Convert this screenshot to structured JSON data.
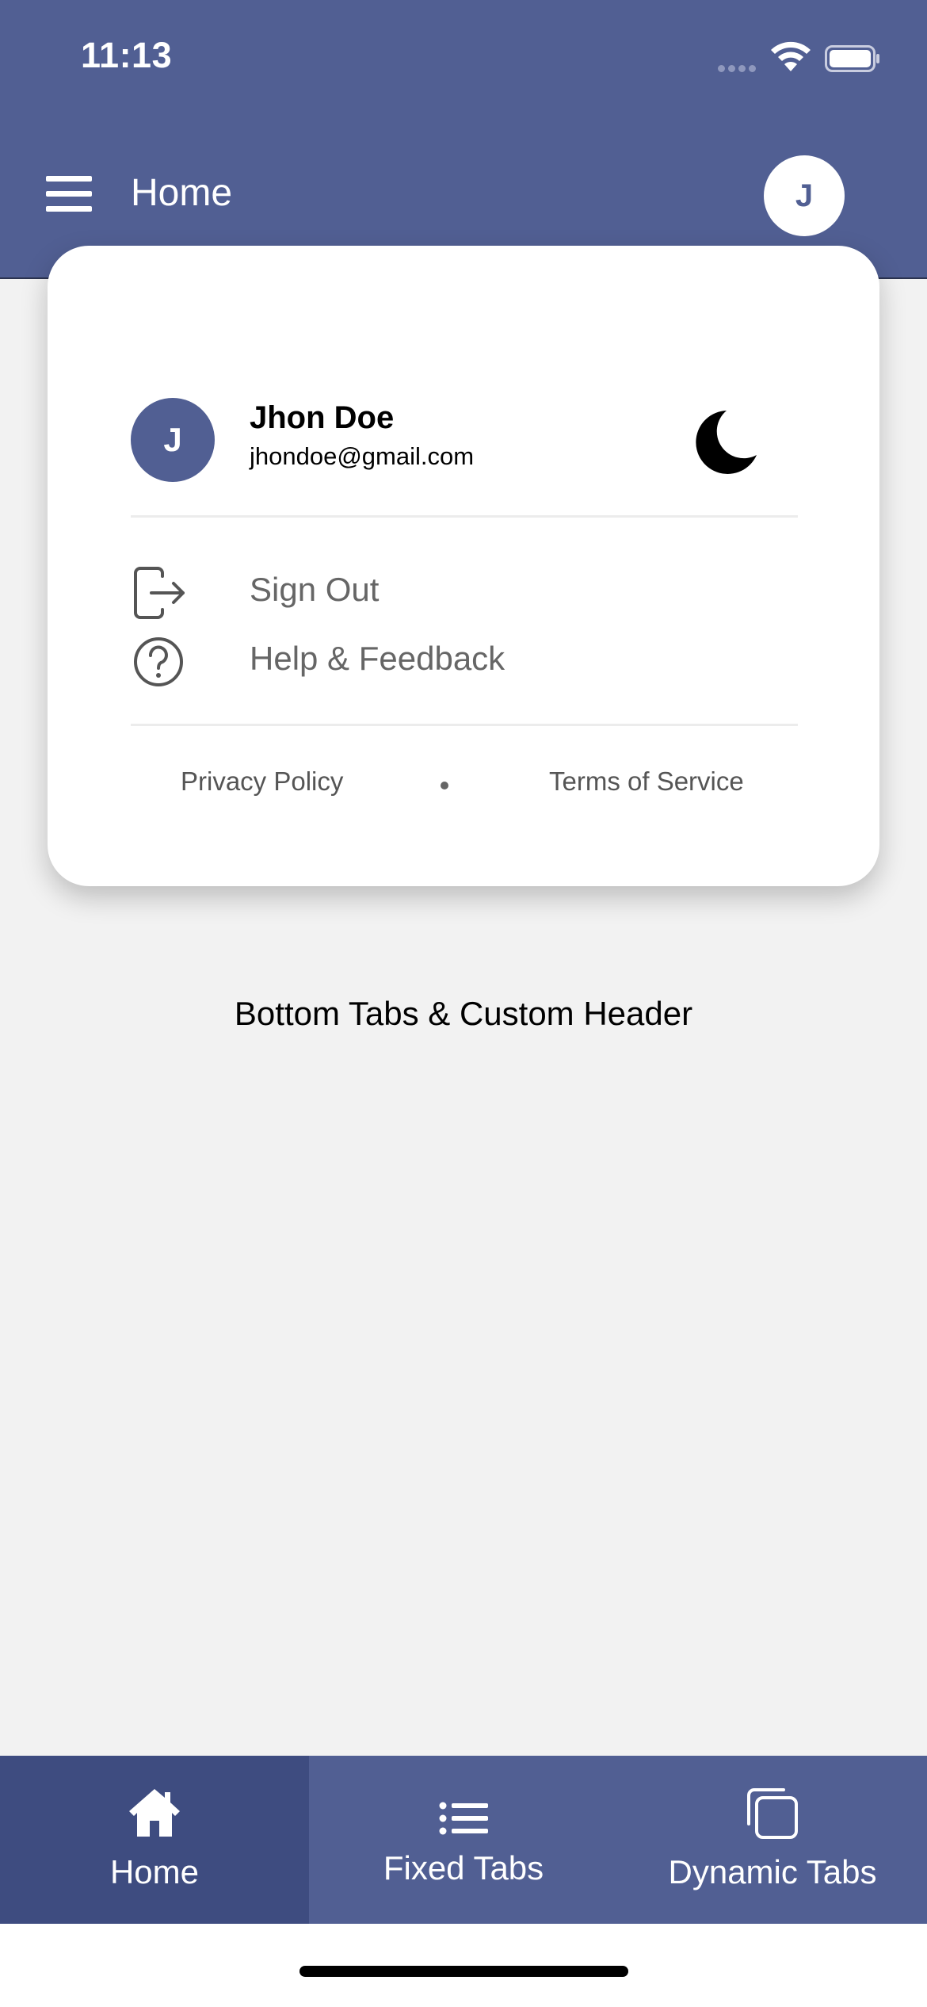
{
  "status_bar": {
    "time": "11:13"
  },
  "header": {
    "title": "Home",
    "avatar_initial": "J"
  },
  "account_popup": {
    "avatar_initial": "J",
    "name": "Jhon Doe",
    "email": "jhondoe@gmail.com",
    "theme_icon": "moon-icon",
    "menu": [
      {
        "label": "Sign Out",
        "icon": "sign-out-icon"
      },
      {
        "label": "Help & Feedback",
        "icon": "help-icon"
      }
    ],
    "footer": {
      "privacy": "Privacy Policy",
      "separator": "•",
      "terms": "Terms of Service"
    }
  },
  "main": {
    "text": "Bottom Tabs & Custom Header"
  },
  "tabs": [
    {
      "label": "Home",
      "icon": "home-icon",
      "active": true
    },
    {
      "label": "Fixed Tabs",
      "icon": "list-icon",
      "active": false
    },
    {
      "label": "Dynamic Tabs",
      "icon": "copy-icon",
      "active": false
    }
  ],
  "colors": {
    "primary": "#515f93",
    "active_tab": "#3e4c80",
    "background": "#f2f2f2"
  }
}
